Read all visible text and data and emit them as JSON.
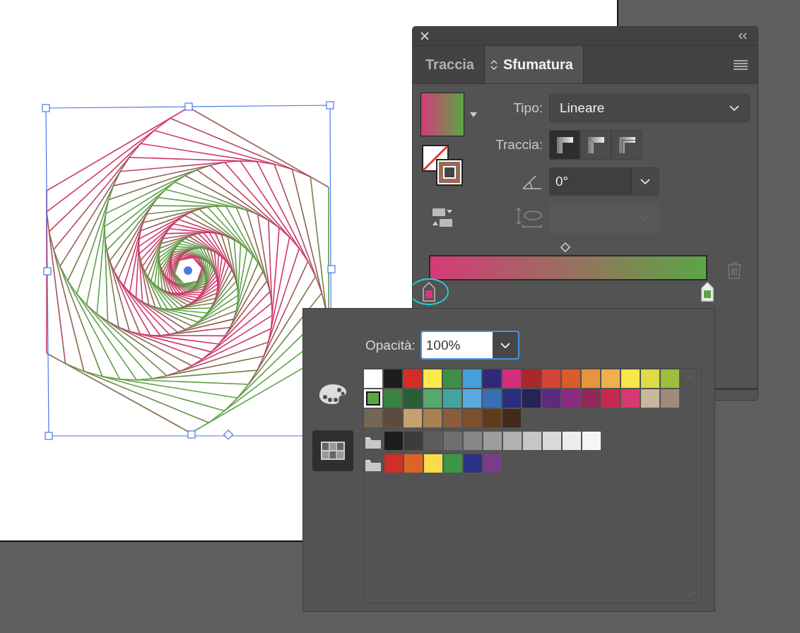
{
  "gradient_panel": {
    "tabs": [
      {
        "label": "Traccia",
        "selected": false
      },
      {
        "label": "Sfumatura",
        "selected": true
      }
    ],
    "type_label": "Tipo:",
    "type_value": "Lineare",
    "stroke_label": "Traccia:",
    "stroke_options": [
      {
        "selected": true
      },
      {
        "selected": false
      },
      {
        "selected": false
      }
    ],
    "angle_value": "0°",
    "aspect_disabled": true,
    "midpoint": {
      "level": 0.49
    },
    "stops": [
      {
        "color": "#d63a78",
        "level": 0,
        "selected": true
      },
      {
        "color": "#5aa646",
        "level": 1,
        "selected": false
      }
    ]
  },
  "swatches_popup": {
    "views": [
      {
        "kind": "palette",
        "selected": false
      },
      {
        "kind": "swatches",
        "selected": true
      }
    ],
    "opacity_label": "Opacità:",
    "opacity_value": "100%",
    "rows": [
      {
        "group": false,
        "swatches": [
          {
            "color": "#ffffff",
            "selected": false
          },
          {
            "color": "#1d1d1b",
            "selected": false
          },
          {
            "color": "#d22e27",
            "selected": false
          },
          {
            "color": "#fbe94a",
            "selected": false
          },
          {
            "color": "#3d9046",
            "selected": false
          },
          {
            "color": "#42a0dd",
            "selected": false
          },
          {
            "color": "#2e2979",
            "selected": false
          },
          {
            "color": "#d42d7e",
            "selected": false
          },
          {
            "color": "#a8282b",
            "selected": false
          },
          {
            "color": "#d44436",
            "selected": false
          },
          {
            "color": "#da5b2b",
            "selected": false
          },
          {
            "color": "#e6953a",
            "selected": false
          },
          {
            "color": "#efb04e",
            "selected": false
          },
          {
            "color": "#f9e64c",
            "selected": false
          },
          {
            "color": "#dedb48",
            "selected": false
          },
          {
            "color": "#9dbe3f",
            "selected": false
          }
        ]
      },
      {
        "group": false,
        "swatches": [
          {
            "color": "#5aa646",
            "selected": true
          },
          {
            "color": "#3a8240",
            "selected": false
          },
          {
            "color": "#2a5e38",
            "selected": false
          },
          {
            "color": "#55a96d",
            "selected": false
          },
          {
            "color": "#44a39a",
            "selected": false
          },
          {
            "color": "#59a9de",
            "selected": false
          },
          {
            "color": "#376fb2",
            "selected": false
          },
          {
            "color": "#2b2e7e",
            "selected": false
          },
          {
            "color": "#26225a",
            "selected": false
          },
          {
            "color": "#5e2a7e",
            "selected": false
          },
          {
            "color": "#8b2a7e",
            "selected": false
          },
          {
            "color": "#93265a",
            "selected": false
          },
          {
            "color": "#c52a4e",
            "selected": false
          },
          {
            "color": "#d53a70",
            "selected": false
          },
          {
            "color": "#c9b69c",
            "selected": false
          },
          {
            "color": "#9f8a7c",
            "selected": false
          }
        ]
      },
      {
        "group": false,
        "swatches": [
          {
            "color": "#766654",
            "selected": false
          },
          {
            "color": "#5d4b3f",
            "selected": false
          },
          {
            "color": "#c6a06e",
            "selected": false
          },
          {
            "color": "#a98050",
            "selected": false
          },
          {
            "color": "#8b5d3a",
            "selected": false
          },
          {
            "color": "#7a5030",
            "selected": false
          },
          {
            "color": "#5f3a1b",
            "selected": false
          },
          {
            "color": "#432a1c",
            "selected": false
          }
        ]
      },
      {
        "group": true,
        "swatches": [
          {
            "color": "#1d1d1b",
            "selected": false
          },
          {
            "color": "#3c3c3b",
            "selected": false
          },
          {
            "color": "#5d5d5c",
            "selected": false
          },
          {
            "color": "#706f6f",
            "selected": false
          },
          {
            "color": "#878787",
            "selected": false
          },
          {
            "color": "#9d9d9c",
            "selected": false
          },
          {
            "color": "#b2b2b2",
            "selected": false
          },
          {
            "color": "#c6c6c6",
            "selected": false
          },
          {
            "color": "#dadada",
            "selected": false
          },
          {
            "color": "#ededed",
            "selected": false
          },
          {
            "color": "#f6f6f6",
            "selected": false
          }
        ]
      },
      {
        "group": true,
        "swatches": [
          {
            "color": "#d12e27",
            "selected": false
          },
          {
            "color": "#dd6429",
            "selected": false
          },
          {
            "color": "#f9dc4a",
            "selected": false
          },
          {
            "color": "#3c9646",
            "selected": false
          },
          {
            "color": "#2c3384",
            "selected": false
          },
          {
            "color": "#793c88",
            "selected": false
          }
        ]
      }
    ]
  }
}
